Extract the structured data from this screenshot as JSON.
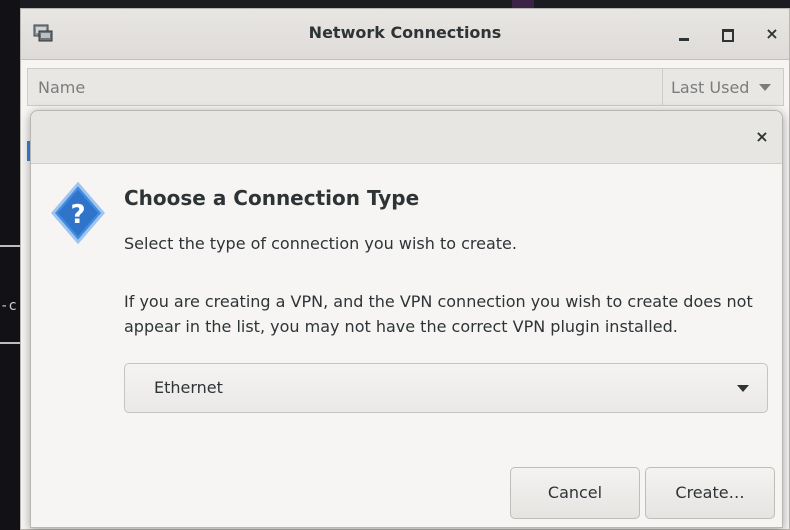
{
  "background_terminal": {
    "fragment": "-c"
  },
  "window": {
    "title": "Network Connections",
    "icons": {
      "app": "network-connections-icon",
      "minimize": "minimize-icon",
      "maximize": "maximize-icon",
      "close": "close-icon"
    },
    "close_glyph": "×"
  },
  "list": {
    "columns": [
      {
        "label": "Name"
      },
      {
        "label": "Last Used",
        "sort_icon": "chevron-down-icon"
      }
    ]
  },
  "dialog": {
    "close_glyph": "×",
    "icon": "question-icon",
    "heading": "Choose a Connection Type",
    "subtitle": "Select the type of connection you wish to create.",
    "note": "If you are creating a VPN, and the VPN connection you wish to create does not appear in the list, you may not have the correct VPN plugin installed.",
    "connection_type": {
      "selected": "Ethernet"
    },
    "buttons": {
      "cancel": "Cancel",
      "create": "Create…"
    }
  },
  "colors": {
    "accent": "#3584e4",
    "question_icon_fill": "#3f8be0",
    "window_bg": "#f6f5f4",
    "background": "#1a1a1f"
  }
}
